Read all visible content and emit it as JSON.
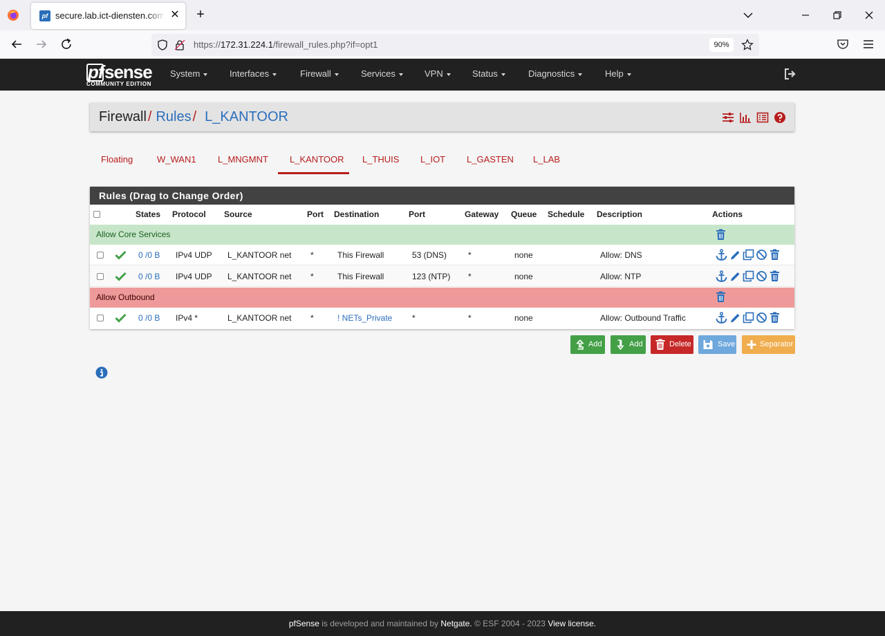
{
  "browser": {
    "tab_title": "secure.lab.ict-diensten.com - Firewall: Rules: L_KANTOOR",
    "url_prefix": "https://",
    "url_host": "172.31.224.1",
    "url_path": "/firewall_rules.php?if=opt1",
    "zoom": "90%"
  },
  "pfsense": {
    "logo_edition": "COMMUNITY EDITION",
    "menu": [
      "System",
      "Interfaces",
      "Firewall",
      "Services",
      "VPN",
      "Status",
      "Diagnostics",
      "Help"
    ]
  },
  "breadcrumb": {
    "root": "Firewall",
    "section": "Rules",
    "current": "L_KANTOOR"
  },
  "interface_tabs": [
    "Floating",
    "W_WAN1",
    "L_MNGMNT",
    "L_KANTOOR",
    "L_THUIS",
    "L_IOT",
    "L_GASTEN",
    "L_LAB"
  ],
  "active_tab": "L_KANTOOR",
  "panel": {
    "title": "Rules (Drag to Change Order)",
    "columns": [
      "States",
      "Protocol",
      "Source",
      "Port",
      "Destination",
      "Port",
      "Gateway",
      "Queue",
      "Schedule",
      "Description",
      "Actions"
    ]
  },
  "rules": {
    "separator_1": "Allow Core Services",
    "row_1": {
      "states": "0 /0 B",
      "protocol": "IPv4 UDP",
      "source": "L_KANTOOR net",
      "src_port": "*",
      "destination": "This Firewall",
      "dst_port": "53 (DNS)",
      "gateway": "*",
      "queue": "none",
      "schedule": "",
      "description": "Allow: DNS"
    },
    "row_2": {
      "states": "0 /0 B",
      "protocol": "IPv4 UDP",
      "source": "L_KANTOOR net",
      "src_port": "*",
      "destination": "This Firewall",
      "dst_port": "123 (NTP)",
      "gateway": "*",
      "queue": "none",
      "schedule": "",
      "description": "Allow: NTP"
    },
    "separator_2": "Allow Outbound",
    "row_3": {
      "states": "0 /0 B",
      "protocol": "IPv4 *",
      "source": "L_KANTOOR net",
      "src_port": "*",
      "destination": "! NETs_Private",
      "dst_port": "*",
      "gateway": "*",
      "queue": "none",
      "schedule": "",
      "description": "Allow: Outbound Traffic"
    }
  },
  "buttons": {
    "add_top": "Add",
    "add_bottom": "Add",
    "delete": "Delete",
    "save": "Save",
    "separator": "Separator"
  },
  "footer": {
    "brand": "pfSense",
    "text1": " is developed and maintained by ",
    "company": "Netgate.",
    "text2": " © ESF 2004 - 2023 ",
    "license": "View license."
  },
  "colors": {
    "nav_bg": "#212121",
    "accent_red": "#b71c1c",
    "link_blue": "#2a6ebb",
    "success_green": "#43a047",
    "separator_green": "#c7e6c9",
    "separator_red": "#ef9a9a"
  }
}
